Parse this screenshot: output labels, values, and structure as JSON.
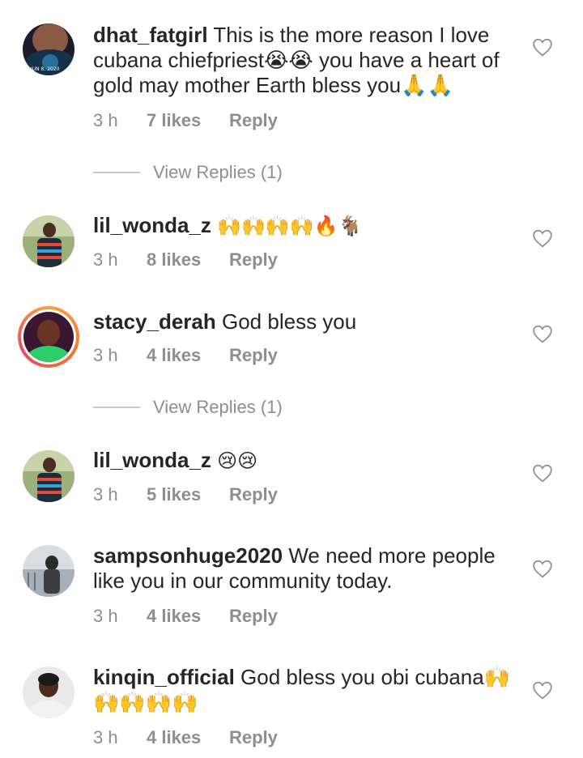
{
  "comments": [
    {
      "username": "dhat_fatgirl",
      "text": "This is the more reason I love cubana chiefpriest😭😭 you have a heart of gold may mother Earth bless you🙏🙏",
      "time": "3 h",
      "likes": "7 likes",
      "reply": "Reply",
      "avatar_label": "JUN 8, 2020"
    },
    {
      "username": "lil_wonda_z",
      "text": "🙌🙌🙌🙌🔥🐐",
      "time": "3 h",
      "likes": "8 likes",
      "reply": "Reply"
    },
    {
      "username": "stacy_derah",
      "text": "God bless you",
      "time": "3 h",
      "likes": "4 likes",
      "reply": "Reply"
    },
    {
      "username": "lil_wonda_z",
      "text": "😢😢",
      "time": "3 h",
      "likes": "5 likes",
      "reply": "Reply"
    },
    {
      "username": "sampsonhuge2020",
      "text": "We need more people like you in our community today.",
      "time": "3 h",
      "likes": "4 likes",
      "reply": "Reply"
    },
    {
      "username": "kinqin_official",
      "text": "God bless you obi cubana🙌🙌🙌🙌🙌",
      "time": "3 h",
      "likes": "4 likes",
      "reply": "Reply"
    }
  ],
  "view_replies": [
    "View Replies (1)",
    "View Replies (1)"
  ],
  "colors": {
    "text": "#262626",
    "muted": "#8e8e8e",
    "story_ring": "#f5792e"
  },
  "icons": {
    "like": "heart-outline-icon"
  }
}
